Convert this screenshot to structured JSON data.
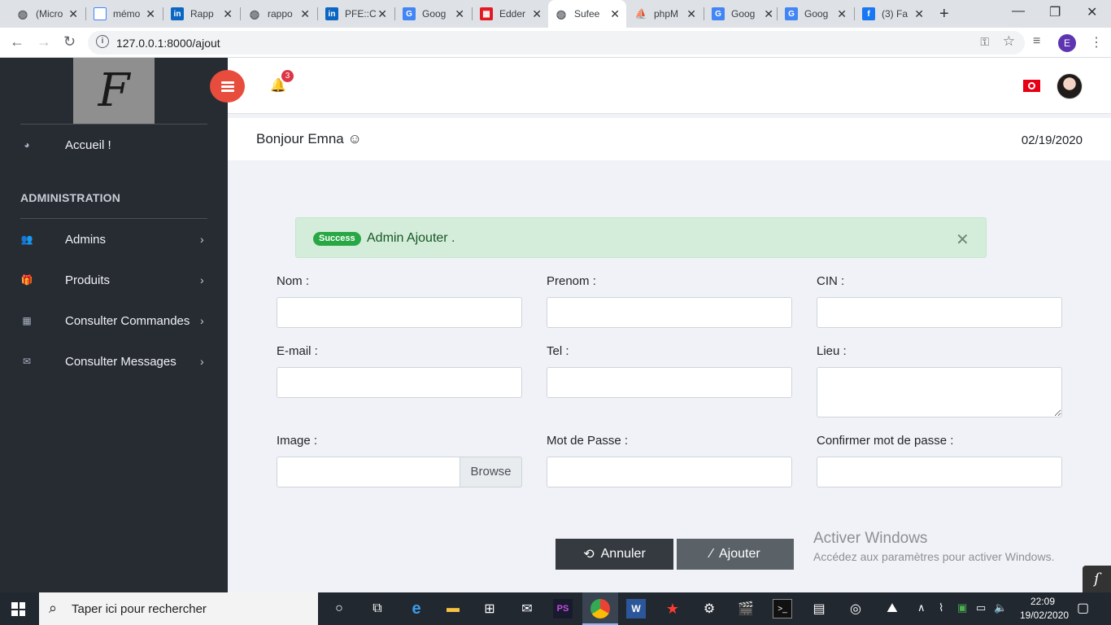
{
  "browser": {
    "tabs": [
      {
        "title": "(Micro",
        "icon": "globe-icon"
      },
      {
        "title": "mémo",
        "icon": "document-icon"
      },
      {
        "title": "Rapp",
        "icon": "linkedin-icon"
      },
      {
        "title": "rappo",
        "icon": "globe-icon"
      },
      {
        "title": "PFE::C",
        "icon": "linkedin-icon"
      },
      {
        "title": "Goog",
        "icon": "google-translate-icon"
      },
      {
        "title": "Edder",
        "icon": "grid-icon"
      },
      {
        "title": "Sufee",
        "icon": "globe-icon"
      },
      {
        "title": "phpM",
        "icon": "phpmyadmin-icon"
      },
      {
        "title": "Goog",
        "icon": "google-translate-icon"
      },
      {
        "title": "Goog",
        "icon": "google-translate-icon"
      },
      {
        "title": "(3) Fa",
        "icon": "facebook-icon"
      }
    ],
    "url": "127.0.0.1:8000/ajout",
    "profile_initial": "E"
  },
  "sidebar": {
    "items": [
      {
        "label": "Accueil !",
        "icon": "dashboard-icon"
      }
    ],
    "section_heading": "ADMINISTRATION",
    "admin_items": [
      {
        "label": "Admins",
        "icon": "users-icon"
      },
      {
        "label": "Produits",
        "icon": "gift-icon"
      },
      {
        "label": "Consulter Commandes",
        "icon": "grid-icon"
      },
      {
        "label": "Consulter Messages",
        "icon": "envelope-icon"
      }
    ]
  },
  "header": {
    "notification_count": "3"
  },
  "greeting": {
    "text": "Bonjour Emna ☺",
    "date": "02/19/2020"
  },
  "alert": {
    "badge": "Success",
    "message": "Admin Ajouter ."
  },
  "form": {
    "nom_label": "Nom :",
    "prenom_label": "Prenom :",
    "cin_label": "CIN :",
    "email_label": "E-mail :",
    "tel_label": "Tel :",
    "lieu_label": "Lieu :",
    "image_label": "Image :",
    "browse_label": "Browse",
    "password_label": "Mot de Passe :",
    "confirm_label": "Confirmer mot de passe :",
    "cancel_label": "Annuler",
    "submit_label": "Ajouter"
  },
  "watermark": {
    "line1": "Activer Windows",
    "line2": "Accédez aux paramètres pour activer Windows."
  },
  "taskbar": {
    "search_placeholder": "Taper ici pour rechercher",
    "time": "22:09",
    "date": "19/02/2020"
  },
  "colors": {
    "sidebar_bg": "#272c33",
    "accent_red": "#e74c3c",
    "success_green": "#28a745",
    "alert_bg": "#d4edda"
  }
}
